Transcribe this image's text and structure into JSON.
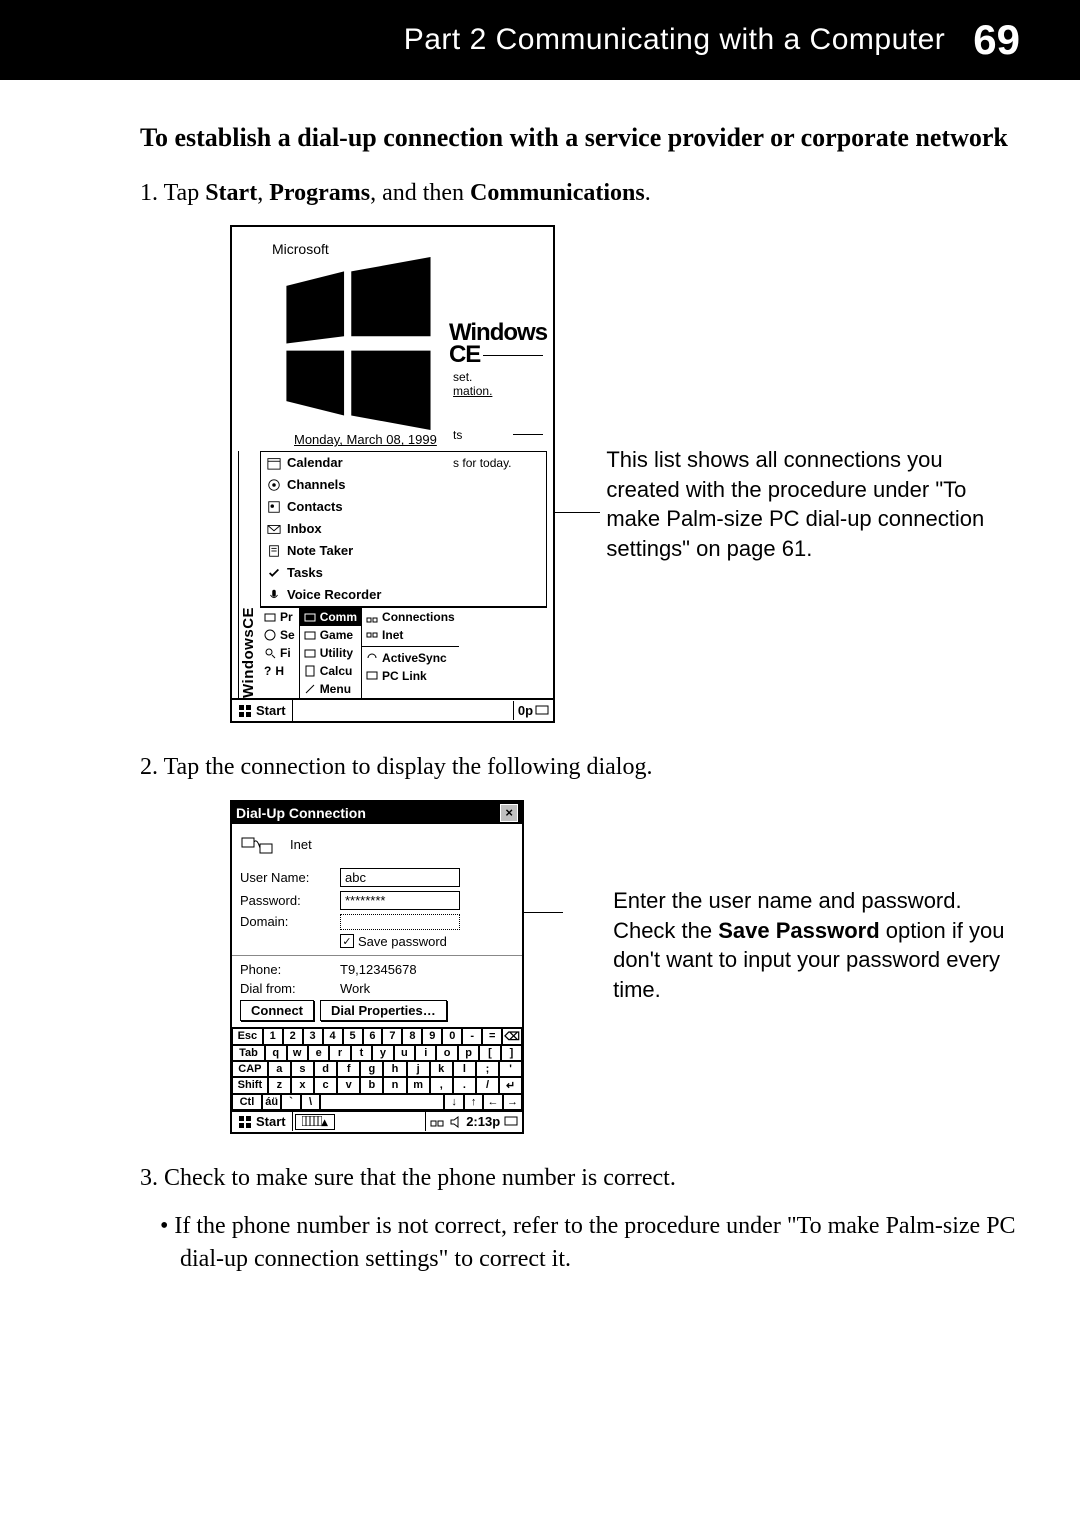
{
  "header": {
    "part_text": "Part 2  Communicating with a Computer",
    "page_num": "69"
  },
  "section_heading": "To establish a dial-up connection with a service provider or corporate network",
  "step1": {
    "prefix": "1. Tap ",
    "b1": "Start",
    "mid1": ", ",
    "b2": "Programs",
    "mid2": ", and then ",
    "b3": "Communications",
    "suffix": "."
  },
  "annotation1": "This list shows all connections you created with the procedure under \"To make Palm-size PC dial-up connection settings\" on page 61.",
  "step2": "2. Tap the connection to display the following dialog.",
  "annotation2": {
    "line1": "Enter the user name and password. Check the ",
    "b": "Save Password",
    "line2": " option if you don't want to input your password every time."
  },
  "step3": "3. Check to make sure that the phone number is correct.",
  "bullet": "•  If the phone number is not correct, refer to the procedure under \"To make Palm-size PC dial-up connection settings\" to correct it.",
  "ce": {
    "microsoft": "Microsoft",
    "brand": "Windows CE",
    "date": "Monday, March 08, 1999",
    "items": [
      "Calendar",
      "Channels",
      "Contacts",
      "Inbox",
      "Note Taker",
      "Tasks",
      "Voice Recorder"
    ],
    "frag1": "set.",
    "frag2": "mation.",
    "frag3": "ts",
    "frag4": "s for today.",
    "col1": [
      "Pr",
      "Se",
      "Fi",
      "H"
    ],
    "col2": [
      "Comm",
      "Game",
      "Utility",
      "Calcu",
      "Menu"
    ],
    "col3": [
      "Connections",
      "Inet",
      "ActiveSync",
      "PC Link"
    ],
    "sidebar": "WindowsCE",
    "start": "Start",
    "tray": "0p"
  },
  "dlg": {
    "title": "Dial-Up Connection",
    "conn_name": "Inet",
    "user_label": "User Name:",
    "user_value": "abc",
    "pass_label": "Password:",
    "pass_value": "********",
    "domain_label": "Domain:",
    "domain_value": "",
    "save_pw_label": "Save password",
    "phone_label": "Phone:",
    "phone_value": "T9,12345678",
    "dialfrom_label": "Dial from:",
    "dialfrom_value": "Work",
    "connect_btn": "Connect",
    "dialprop_btn": "Dial Properties…",
    "osk_row1": [
      "Esc",
      "1",
      "2",
      "3",
      "4",
      "5",
      "6",
      "7",
      "8",
      "9",
      "0",
      "-",
      "=",
      "⌫"
    ],
    "osk_row2": [
      "Tab",
      "q",
      "w",
      "e",
      "r",
      "t",
      "y",
      "u",
      "i",
      "o",
      "p",
      "[",
      "]"
    ],
    "osk_row3": [
      "CAP",
      "a",
      "s",
      "d",
      "f",
      "g",
      "h",
      "j",
      "k",
      "l",
      ";",
      "'"
    ],
    "osk_row4": [
      "Shift",
      "z",
      "x",
      "c",
      "v",
      "b",
      "n",
      "m",
      ",",
      ".",
      "/",
      "↵"
    ],
    "osk_row5": [
      "Ctl",
      "áü",
      "`",
      "\\",
      " ",
      "↓",
      "↑",
      "←",
      "→"
    ],
    "start": "Start",
    "time": "2:13p"
  }
}
